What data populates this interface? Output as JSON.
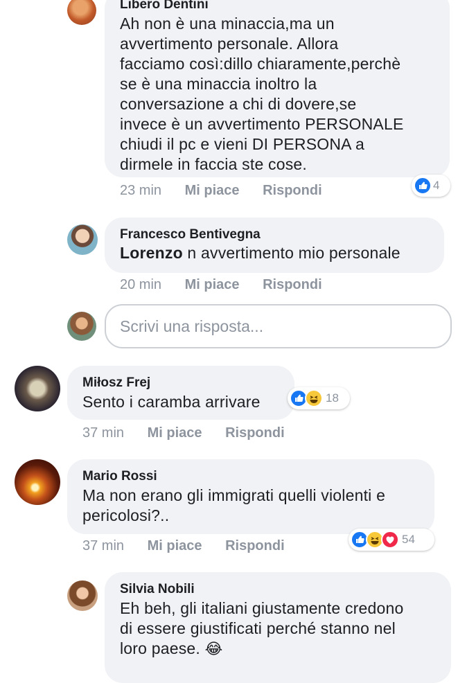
{
  "comments": [
    {
      "author": "Libero Dentini",
      "lines": [
        "Ah non è una minaccia,ma un",
        "avvertimento personale. Allora",
        "facciamo così:dillo chiaramente,perchè",
        "se è una minaccia inoltro la",
        "conversazione a chi di dovere,se",
        "invece è un avvertimento PERSONALE",
        "chiudi il pc e vieni DI PERSONA a",
        "dirmele in faccia ste cose."
      ],
      "time": "23 min",
      "like": "Mi piace",
      "reply": "Rispondi",
      "reaction_count": "4",
      "reactions": [
        "like-icon"
      ]
    },
    {
      "author": "Francesco Bentivegna",
      "mention": "Lorenzo",
      "text": " n avvertimento mio personale",
      "time": "20 min",
      "like": "Mi piace",
      "reply": "Rispondi"
    },
    {
      "author": "Miłosz Frej",
      "text": "Sento i caramba arrivare",
      "time": "37 min",
      "like": "Mi piace",
      "reply": "Rispondi",
      "reaction_count": "18",
      "reactions": [
        "like-icon",
        "haha-icon"
      ]
    },
    {
      "author": "Mario Rossi",
      "lines": [
        "Ma non erano gli immigrati quelli violenti e",
        "pericolosi?.."
      ],
      "time": "37 min",
      "like": "Mi piace",
      "reply": "Rispondi",
      "reaction_count": "54",
      "reactions": [
        "like-icon",
        "haha-icon",
        "love-icon"
      ]
    },
    {
      "author": "Silvia Nobili",
      "lines": [
        "Eh beh, gli italiani giustamente credono",
        "di essere giustificati perché stanno nel",
        "loro paese."
      ],
      "emoji": "😂"
    }
  ],
  "reply_box": {
    "placeholder": "Scrivi una risposta..."
  },
  "colors": {
    "bubble": "#f0f2f5",
    "meta": "#8d949e",
    "like": "#1877f2",
    "haha": "#f7c83a",
    "love": "#f0284a"
  }
}
